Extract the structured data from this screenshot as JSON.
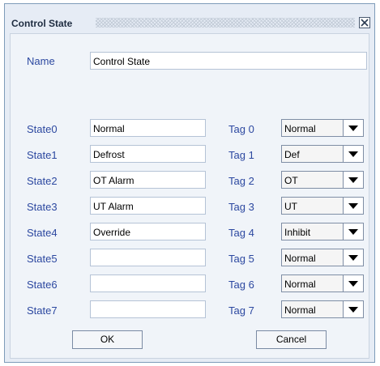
{
  "window": {
    "title": "Control State"
  },
  "name_row": {
    "label": "Name",
    "value": "Control State"
  },
  "states": [
    {
      "label": "State0",
      "value": "Normal",
      "tag_label": "Tag 0",
      "tag_value": "Normal"
    },
    {
      "label": "State1",
      "value": "Defrost",
      "tag_label": "Tag 1",
      "tag_value": "Def"
    },
    {
      "label": "State2",
      "value": "OT Alarm",
      "tag_label": "Tag 2",
      "tag_value": "OT"
    },
    {
      "label": "State3",
      "value": "UT Alarm",
      "tag_label": "Tag 3",
      "tag_value": "UT"
    },
    {
      "label": "State4",
      "value": "Override",
      "tag_label": "Tag 4",
      "tag_value": "Inhibit"
    },
    {
      "label": "State5",
      "value": "",
      "tag_label": "Tag 5",
      "tag_value": "Normal"
    },
    {
      "label": "State6",
      "value": "",
      "tag_label": "Tag 6",
      "tag_value": "Normal"
    },
    {
      "label": "State7",
      "value": "",
      "tag_label": "Tag 7",
      "tag_value": "Normal"
    }
  ],
  "buttons": {
    "ok": "OK",
    "cancel": "Cancel"
  },
  "colors": {
    "label": "#2c48a0",
    "panel": "#f0f4f9",
    "frame": "#e6ecf5"
  }
}
